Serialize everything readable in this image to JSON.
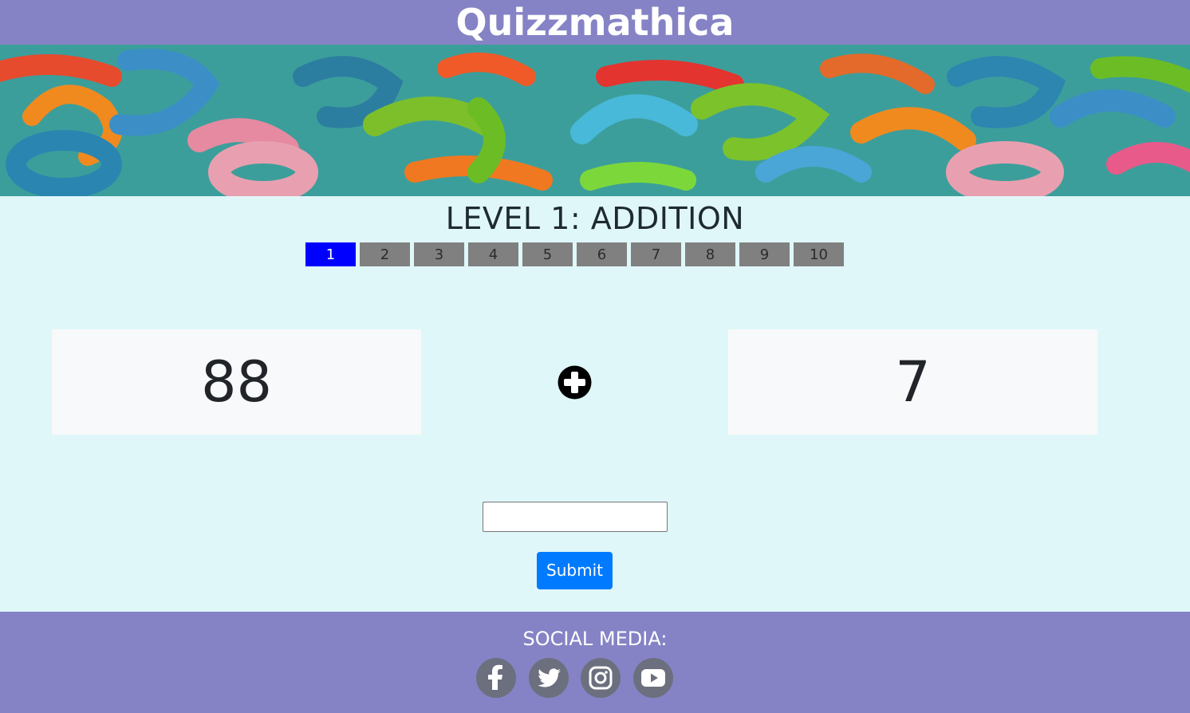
{
  "header": {
    "title": "Quizzmathica"
  },
  "banner": {
    "icon": "number-pattern-image"
  },
  "level": {
    "title": "LEVEL 1: ADDITION"
  },
  "progress": {
    "steps": [
      "1",
      "2",
      "3",
      "4",
      "5",
      "6",
      "7",
      "8",
      "9",
      "10"
    ],
    "current": 1,
    "active_color": "#0000ff",
    "inactive_color": "#808080"
  },
  "question": {
    "operand_left": "88",
    "operator_icon": "plus-circle-icon",
    "operand_right": "7"
  },
  "answer": {
    "value": "",
    "placeholder": ""
  },
  "submit": {
    "label": "Submit",
    "color": "#007bff"
  },
  "footer": {
    "social_title": "SOCIAL MEDIA:",
    "icons": [
      "facebook-icon",
      "twitter-icon",
      "instagram-icon",
      "youtube-icon"
    ]
  },
  "colors": {
    "header_bg": "#8583c5",
    "page_bg": "#e0f7f9"
  }
}
